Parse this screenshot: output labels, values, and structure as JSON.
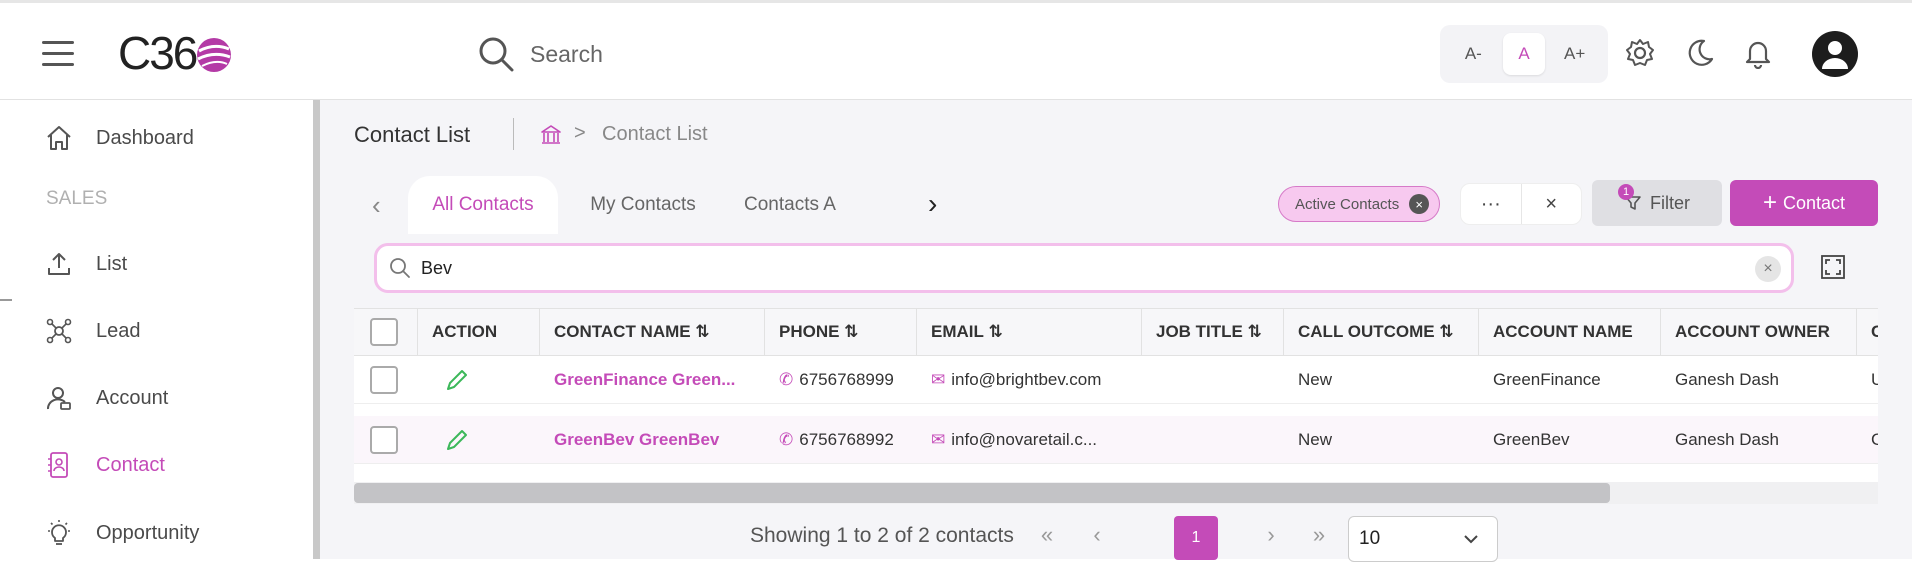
{
  "header": {
    "logo_text": "C36",
    "search_label": "Search",
    "font_sizes": [
      "A-",
      "A",
      "A+"
    ],
    "active_font_size": "A"
  },
  "sidebar": {
    "section_label": "SALES",
    "items": [
      {
        "label": "Dashboard",
        "icon": "home-icon"
      },
      {
        "label": "List",
        "icon": "upload-icon"
      },
      {
        "label": "Lead",
        "icon": "network-icon"
      },
      {
        "label": "Account",
        "icon": "user-account-icon"
      },
      {
        "label": "Contact",
        "icon": "contact-card-icon",
        "active": true
      },
      {
        "label": "Opportunity",
        "icon": "lightbulb-icon"
      }
    ]
  },
  "main": {
    "title": "Contact List",
    "breadcrumb": {
      "separator": ">",
      "current": "Contact List"
    },
    "tabs": [
      {
        "label": "All Contacts",
        "active": true
      },
      {
        "label": "My Contacts"
      },
      {
        "label": "Contacts A"
      }
    ],
    "active_filter_chip": "Active Contacts",
    "filter_label": "Filter",
    "filter_count": "1",
    "add_button_label": "Contact",
    "grid_search_value": "Bev",
    "table": {
      "columns": [
        "ACTION",
        "CONTACT NAME",
        "PHONE",
        "EMAIL",
        "JOB TITLE",
        "CALL OUTCOME",
        "ACCOUNT NAME",
        "ACCOUNT OWNER",
        "C"
      ],
      "rows": [
        {
          "name": "GreenFinance Green...",
          "phone": "6756768999",
          "email": "info@brightbev.com",
          "job_title": "",
          "call_outcome": "New",
          "account_name": "GreenFinance",
          "account_owner": "Ganesh Dash",
          "extra": "U"
        },
        {
          "name": "GreenBev GreenBev",
          "phone": "6756768992",
          "email": "info@novaretail.c...",
          "job_title": "",
          "call_outcome": "New",
          "account_name": "GreenBev",
          "account_owner": "Ganesh Dash",
          "extra": "C"
        }
      ]
    },
    "pagination": {
      "summary": "Showing 1 to 2 of 2 contacts",
      "current_page": "1",
      "page_size": "10"
    }
  },
  "colors": {
    "accent": "#c44bb8",
    "chip_bg": "#f7c9ef"
  }
}
